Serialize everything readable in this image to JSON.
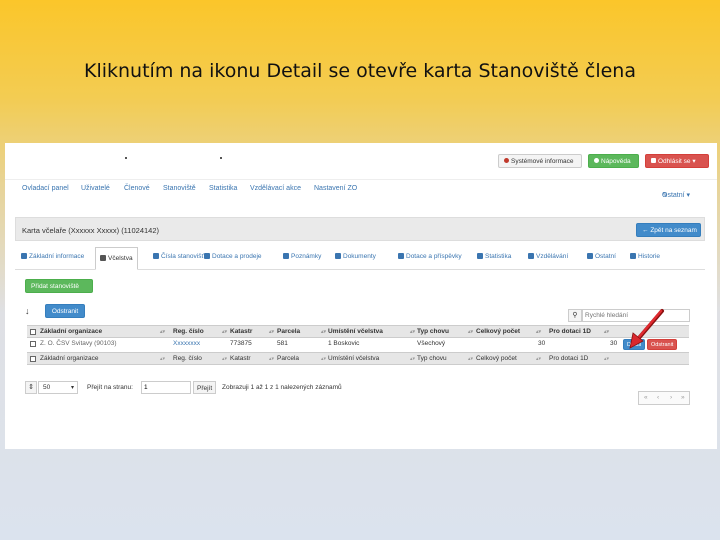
{
  "slide": {
    "title": "Kliknutím na ikonu Detail se otevře karta Stanoviště člena"
  },
  "topbar": {
    "system_info": "Systémové informace",
    "help": "Nápověda",
    "user": "Odhlásit se"
  },
  "nav": {
    "items": [
      "Ovladací panel",
      "Uživatelé",
      "Členové",
      "Stanoviště",
      "Statistika",
      "Vzdělávací akce",
      "Nastavení ZO"
    ],
    "right": "Ostatní ▾"
  },
  "card": {
    "title": "Karta včelaře (Xxxxxx Xxxxx) (11024142)",
    "back_button": "Zpět na seznam"
  },
  "tabs": [
    "Základní informace",
    "Včelstva",
    "Čísla stanovišť",
    "Dotace a prodeje",
    "Poznámky",
    "Dokumenty",
    "Dotace a příspěvky",
    "Statistika",
    "Vzdělávání",
    "Ostatní",
    "Historie"
  ],
  "actions": {
    "add": "Přidat stanoviště",
    "remove": "Odstranit"
  },
  "search": {
    "placeholder": "Rychlé hledání"
  },
  "table": {
    "columns": [
      "Základní organizace",
      "Reg. číslo",
      "Katastr",
      "Parcela",
      "Umístění včelstva",
      "Typ chovu",
      "Celkový počet",
      "Pro dotaci 1D"
    ],
    "rows": [
      {
        "org": "Z. O. ČSV Svitavy (90103)",
        "reg": "Xxxxxxxx",
        "katastr": "773875",
        "parcela": "581",
        "umisteni": "1 Boskovic",
        "typ": "Všechový",
        "celkem": "30",
        "dotace": "30"
      }
    ],
    "footer": [
      "Základní organizace",
      "Reg. číslo",
      "Katastr",
      "Parcela",
      "Umístění včelstva",
      "Typ chovu",
      "Celkový počet",
      "Pro dotaci 1D"
    ],
    "detail_button": "Detail",
    "remove_button": "Odstranit"
  },
  "pager": {
    "page_size": "50",
    "goto_label": "Přejít na stranu:",
    "page_value": "1",
    "go_button": "Přejít",
    "info": "Zobrazuji 1 až 1 z 1 nalezených záznamů",
    "nav_buttons": [
      "«",
      "‹",
      "›",
      "»"
    ]
  },
  "colors": {
    "accent": "#428bca",
    "arrow": "#d9282e",
    "success": "#5cb85c",
    "danger": "#d9534f"
  }
}
